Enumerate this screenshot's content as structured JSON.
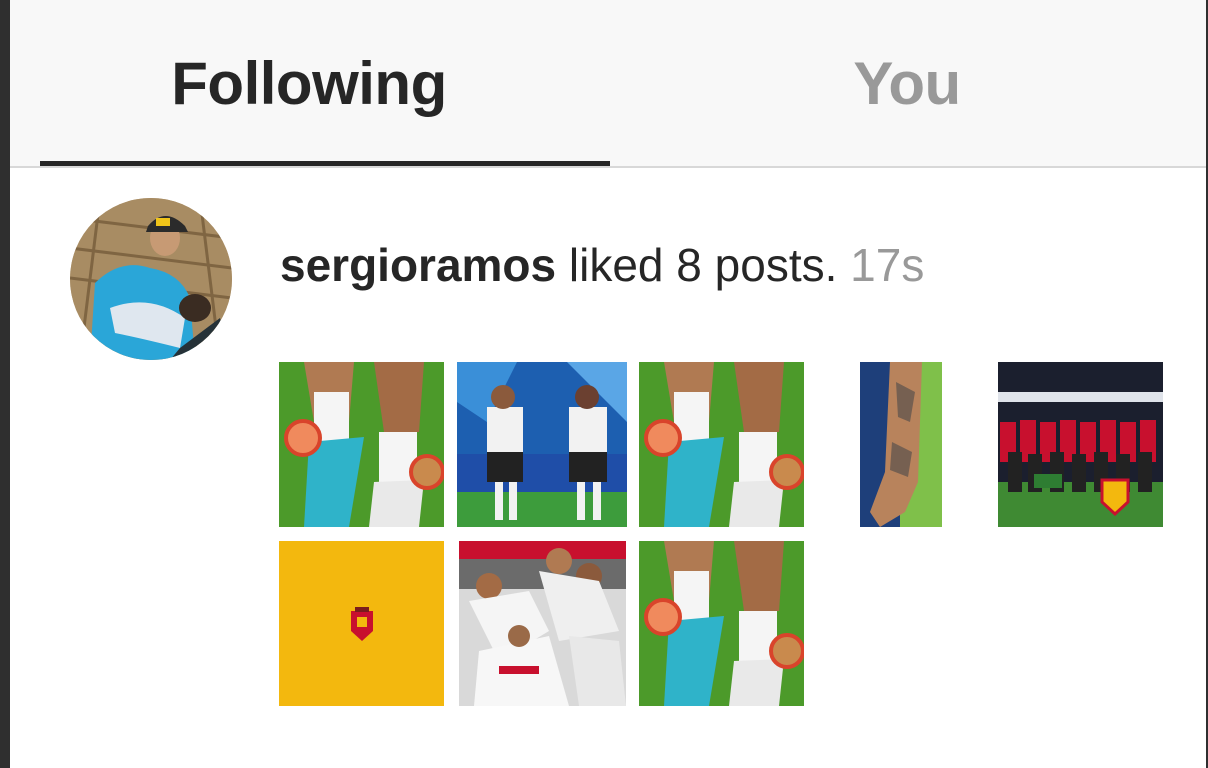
{
  "tabs": {
    "following_label": "Following",
    "you_label": "You",
    "active": "Following"
  },
  "activity": {
    "username": "sergioramos",
    "action_text": " liked 8 posts. ",
    "time": "17s"
  },
  "colors": {
    "active_tab": "#262626",
    "inactive_tab": "#999999",
    "timestamp": "#999999",
    "tab_bar_bg": "#f8f8f8",
    "spain_yellow": "#f3b80e",
    "spain_red": "#c8102e"
  },
  "posts": [
    {
      "name": "post-thumbnail-boots-1",
      "kind": "boots"
    },
    {
      "name": "post-thumbnail-players-covering-faces",
      "kind": "players"
    },
    {
      "name": "post-thumbnail-boots-2",
      "kind": "boots"
    },
    {
      "name": "post-thumbnail-tattooed-arm",
      "kind": "arm"
    },
    {
      "name": "post-thumbnail-team-lineup",
      "kind": "lineup"
    },
    {
      "name": "post-thumbnail-spain-crest",
      "kind": "crest"
    },
    {
      "name": "post-thumbnail-team-celebration",
      "kind": "celebration"
    },
    {
      "name": "post-thumbnail-boots-3",
      "kind": "boots"
    }
  ]
}
